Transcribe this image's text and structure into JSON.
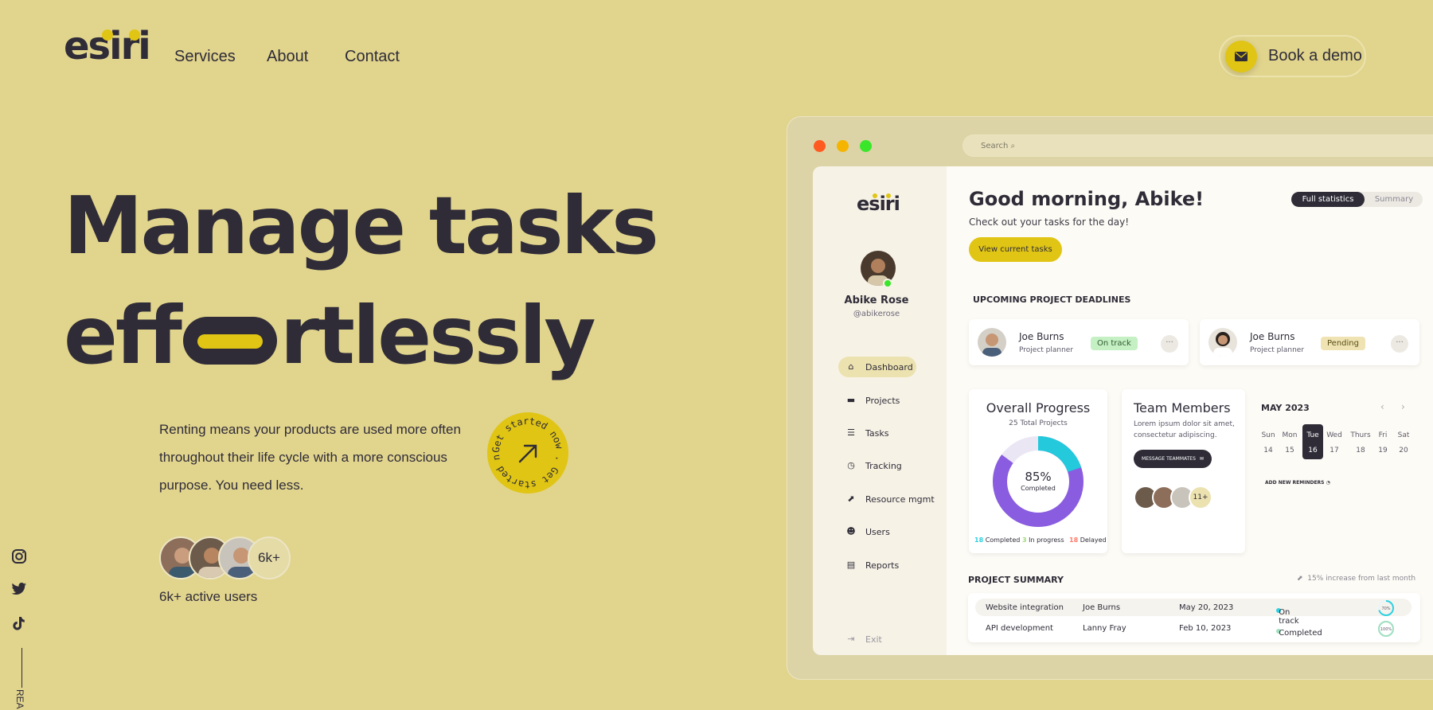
{
  "brand": {
    "name": "esiri"
  },
  "nav": {
    "services": "Services",
    "about": "About",
    "contact": "Contact"
  },
  "cta": {
    "book_demo": "Book a demo"
  },
  "hero": {
    "line1": "Manage tasks",
    "line2_start": "eff",
    "line2_end": "rtlessly",
    "description": "Renting means your products are used more often throughout their life cycle with a more conscious purpose. You need less.",
    "badge_text": "Get started now . Get started now . ",
    "user_count": "6k+",
    "users_label": "6k+ active users",
    "side_text": "REA"
  },
  "colors": {
    "background": "#e1d48d",
    "accent": "#e0c514",
    "dark": "#2f2c38"
  },
  "window": {
    "search_placeholder": "Search"
  },
  "sidebar": {
    "brand": "esiri",
    "user_name": "Abike Rose",
    "user_handle": "@abikerose",
    "items": [
      {
        "label": "Dashboard",
        "icon": "home-icon"
      },
      {
        "label": "Projects",
        "icon": "briefcase-icon"
      },
      {
        "label": "Tasks",
        "icon": "list-icon"
      },
      {
        "label": "Tracking",
        "icon": "clock-icon"
      },
      {
        "label": "Resource mgmt",
        "icon": "chart-icon"
      },
      {
        "label": "Users",
        "icon": "users-icon"
      },
      {
        "label": "Reports",
        "icon": "clipboard-icon"
      }
    ],
    "exit": "Exit"
  },
  "dashboard": {
    "greeting": "Good morning, Abike!",
    "subtitle": "Check out your tasks for the day!",
    "view_tasks": "View current tasks",
    "toggle": {
      "full": "Full statistics",
      "summary": "Summary"
    },
    "deadlines_title": "UPCOMING PROJECT DEADLINES",
    "deadlines": [
      {
        "name": "Joe Burns",
        "role": "Project planner",
        "status": "On track"
      },
      {
        "name": "Joe Burns",
        "role": "Project planner",
        "status": "Pending"
      }
    ],
    "progress": {
      "title": "Overall Progress",
      "total": "25 Total Projects",
      "percent": "85%",
      "percent_label": "Completed",
      "percent_value": 85,
      "legend": [
        {
          "count": "18",
          "label": "Completed",
          "color": "#2fd0e0"
        },
        {
          "count": "3",
          "label": "In progress",
          "color": "#9fd87a"
        },
        {
          "count": "18",
          "label": "Delayed",
          "color": "#ff7b6b"
        }
      ]
    },
    "team": {
      "title": "Team Members",
      "text1": "Lorem ipsum dolor sit amet,",
      "text2": "consectetur adipiscing.",
      "button": "MESSAGE TEAMMATES",
      "more": "11+"
    },
    "calendar": {
      "month": "MAY 2023",
      "days": [
        "Sun",
        "Mon",
        "Tue",
        "Wed",
        "Thurs",
        "Fri",
        "Sat"
      ],
      "dates": [
        "14",
        "15",
        "16",
        "17",
        "18",
        "19",
        "20"
      ],
      "reminder": "ADD NEW REMINDERS"
    },
    "summary": {
      "title": "PROJECT SUMMARY",
      "trend": "15% increase from last month",
      "rows": [
        {
          "project": "Website integration",
          "owner": "Joe Burns",
          "date": "May 20, 2023",
          "status": "On track",
          "pct": "70%",
          "pct_value": 70,
          "color": "#2fd0e0"
        },
        {
          "project": "API development",
          "owner": "Lanny Fray",
          "date": "Feb 10, 2023",
          "status": "Completed",
          "pct": "100%",
          "pct_value": 100,
          "color": "#9fe0c0"
        }
      ]
    }
  }
}
